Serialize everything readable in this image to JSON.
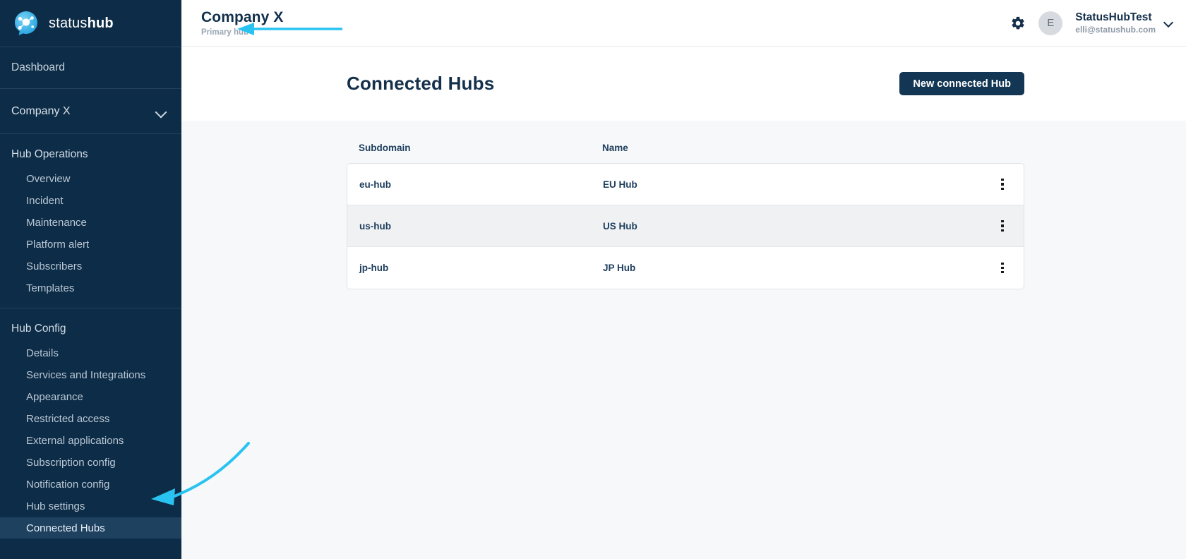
{
  "brand": {
    "name_light": "status",
    "name_bold": "hub",
    "logo_icon": "statushub-logo-icon"
  },
  "sidebar": {
    "dashboard_label": "Dashboard",
    "company_label": "Company X",
    "company_chevron_icon": "chevron-down-icon",
    "groups": [
      {
        "title": "Hub Operations",
        "items": [
          {
            "label": "Overview",
            "active": false
          },
          {
            "label": "Incident",
            "active": false
          },
          {
            "label": "Maintenance",
            "active": false
          },
          {
            "label": "Platform alert",
            "active": false
          },
          {
            "label": "Subscribers",
            "active": false
          },
          {
            "label": "Templates",
            "active": false
          }
        ]
      },
      {
        "title": "Hub Config",
        "items": [
          {
            "label": "Details",
            "active": false
          },
          {
            "label": "Services and Integrations",
            "active": false
          },
          {
            "label": "Appearance",
            "active": false
          },
          {
            "label": "Restricted access",
            "active": false
          },
          {
            "label": "External applications",
            "active": false
          },
          {
            "label": "Subscription config",
            "active": false
          },
          {
            "label": "Notification config",
            "active": false
          },
          {
            "label": "Hub settings",
            "active": false
          },
          {
            "label": "Connected Hubs",
            "active": true
          }
        ]
      }
    ]
  },
  "topbar": {
    "hub_title": "Company X",
    "hub_subtitle": "Primary hub",
    "settings_icon": "gear-icon",
    "avatar_initial": "E",
    "user_name": "StatusHubTest",
    "user_email": "elli@statushub.com",
    "user_menu_chevron_icon": "chevron-down-icon"
  },
  "page": {
    "title": "Connected Hubs",
    "new_hub_button": "New connected Hub"
  },
  "table": {
    "columns": [
      "Subdomain",
      "Name"
    ],
    "rows": [
      {
        "subdomain": "eu-hub",
        "name": "EU Hub",
        "menu_icon": "kebab-menu-icon"
      },
      {
        "subdomain": "us-hub",
        "name": "US Hub",
        "menu_icon": "kebab-menu-icon"
      },
      {
        "subdomain": "jp-hub",
        "name": "JP Hub",
        "menu_icon": "kebab-menu-icon"
      }
    ]
  },
  "annotations": {
    "color": "#29c3f2",
    "arrow_to_primary_hub": "straight-arrow-left",
    "arrow_to_connected_hubs": "curved-arrow-left"
  }
}
